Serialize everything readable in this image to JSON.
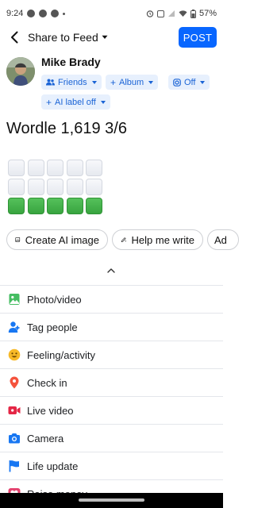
{
  "status_bar": {
    "time": "9:24",
    "battery": "57%"
  },
  "header": {
    "title": "Share to Feed",
    "post_label": "POST"
  },
  "composer": {
    "user_name": "Mike Brady",
    "audience": "Friends",
    "album": "Album",
    "ai_toggle": "Off",
    "ai_label": "AI label off",
    "text": "Wordle 1,619 3/6"
  },
  "wordle_rows": [
    [
      "empty",
      "empty",
      "empty",
      "empty",
      "empty"
    ],
    [
      "empty",
      "empty",
      "empty",
      "empty",
      "empty"
    ],
    [
      "green",
      "green",
      "green",
      "green",
      "green"
    ]
  ],
  "ai_actions": [
    {
      "label": "Create AI image",
      "icon": "image-sparkle-icon"
    },
    {
      "label": "Help me write",
      "icon": "pen-sparkle-icon"
    },
    {
      "label": "Ad",
      "icon": ""
    }
  ],
  "menu": [
    {
      "label": "Photo/video",
      "icon": "photo-icon",
      "color": "#45bd62"
    },
    {
      "label": "Tag people",
      "icon": "tag-people-icon",
      "color": "#1877f2"
    },
    {
      "label": "Feeling/activity",
      "icon": "smiley-icon",
      "color": "#f7b928"
    },
    {
      "label": "Check in",
      "icon": "location-pin-icon",
      "color": "#f5533d"
    },
    {
      "label": "Live video",
      "icon": "live-video-icon",
      "color": "#e42645"
    },
    {
      "label": "Camera",
      "icon": "camera-icon",
      "color": "#1877f2"
    },
    {
      "label": "Life update",
      "icon": "flag-icon",
      "color": "#1877f2"
    },
    {
      "label": "Raise money",
      "icon": "heart-icon",
      "color": "#e4426e"
    }
  ]
}
